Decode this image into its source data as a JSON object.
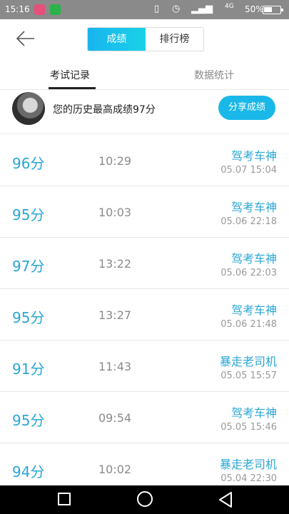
{
  "status_bar": {
    "time": "15:16",
    "battery": "50%",
    "signal_label": "4G",
    "icons": [
      "notification-icon",
      "wechat-icon",
      "vibrate-icon",
      "alarm-icon",
      "signal-icon",
      "battery-icon"
    ]
  },
  "header": {
    "segments": [
      "成绩",
      "排行榜"
    ],
    "active_segment": "成绩",
    "accent_color": "#19b4ee"
  },
  "tabs": {
    "records": "考试记录",
    "stats": "数据统计",
    "active": "考试记录"
  },
  "banner": {
    "text": "您的历史最高成绩97分",
    "share_label": "分享成绩"
  },
  "records": [
    {
      "score": "96分",
      "duration": "10:29",
      "title": "驾考车神",
      "date": "05.07  15:04"
    },
    {
      "score": "95分",
      "duration": "10:03",
      "title": "驾考车神",
      "date": "05.06  22:18"
    },
    {
      "score": "97分",
      "duration": "13:22",
      "title": "驾考车神",
      "date": "05.06  22:03"
    },
    {
      "score": "95分",
      "duration": "13:27",
      "title": "驾考车神",
      "date": "05.06  21:48"
    },
    {
      "score": "91分",
      "duration": "11:43",
      "title": "暴走老司机",
      "date": "05.05  15:57"
    },
    {
      "score": "95分",
      "duration": "09:54",
      "title": "驾考车神",
      "date": "05.05  15:46"
    },
    {
      "score": "94分",
      "duration": "10:02",
      "title": "暴走老司机",
      "date": "05.04  22:30"
    }
  ]
}
